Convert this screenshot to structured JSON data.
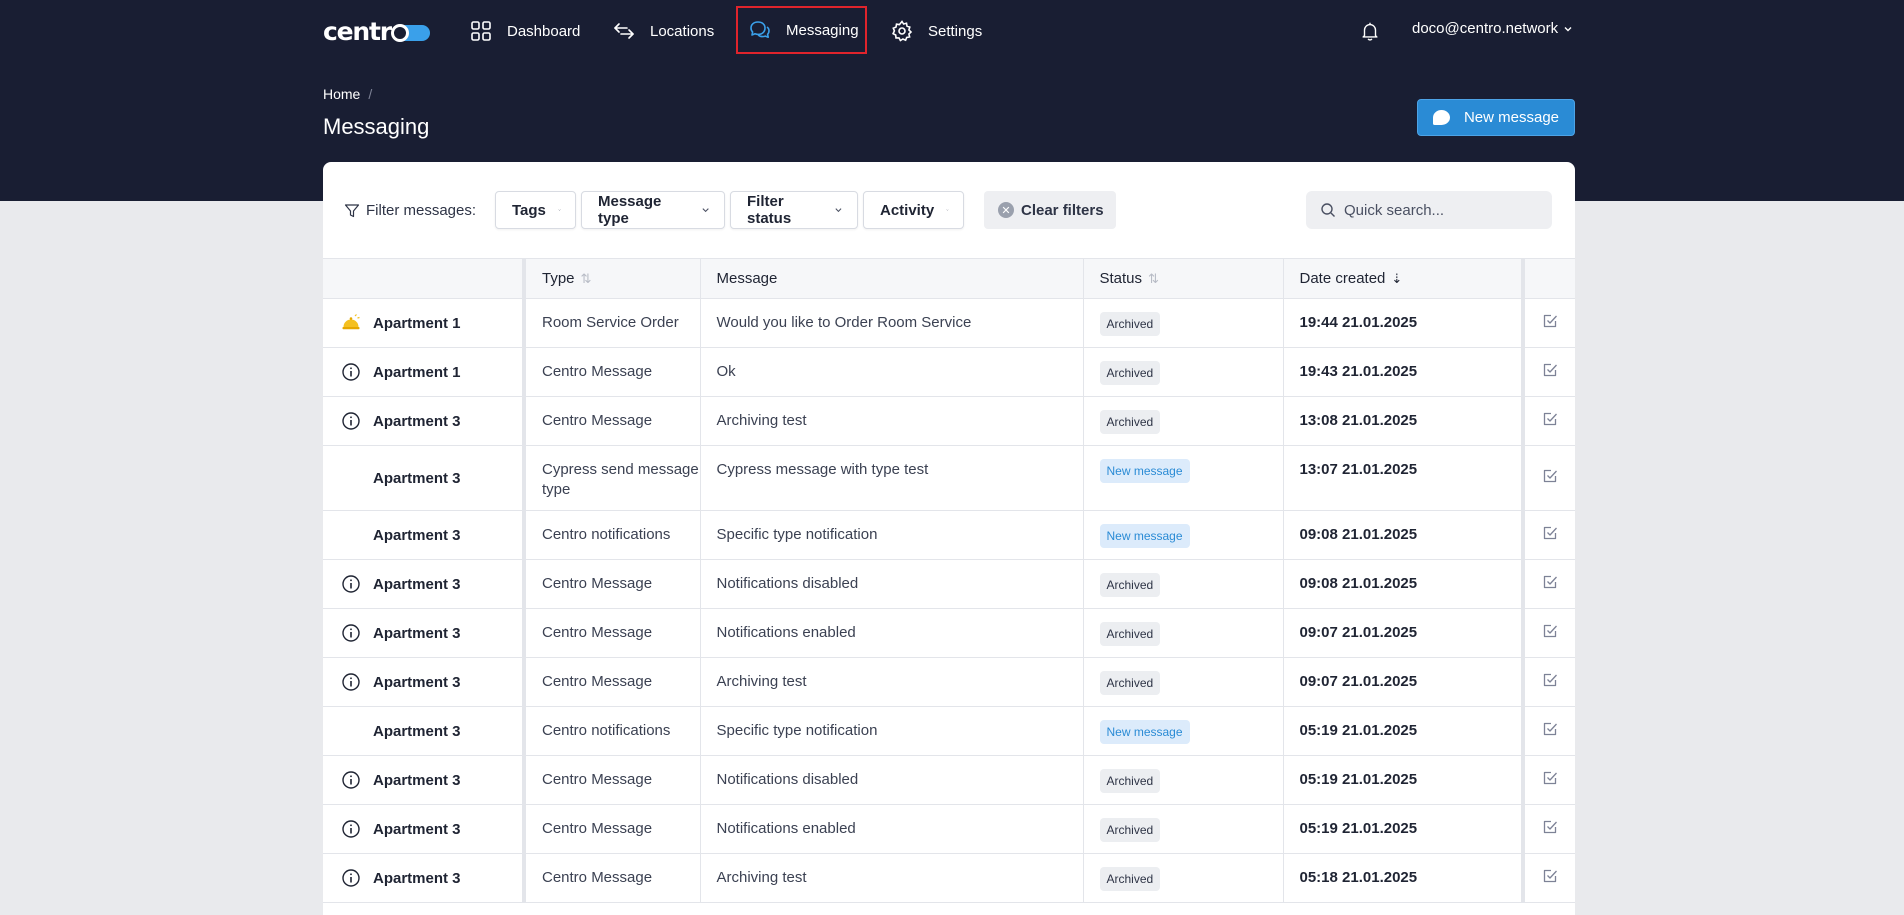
{
  "brand": {
    "logo_text": "centr"
  },
  "nav": {
    "items": [
      {
        "label": "Dashboard",
        "icon": "dashboard-grid-icon"
      },
      {
        "label": "Locations",
        "icon": "arrows-swap-icon"
      },
      {
        "label": "Messaging",
        "icon": "chat-bubbles-icon",
        "active": true
      },
      {
        "label": "Settings",
        "icon": "gear-icon"
      }
    ],
    "user_email": "doco@centro.network"
  },
  "breadcrumb": {
    "home": "Home",
    "separator": "/"
  },
  "page_title": "Messaging",
  "new_message_button": "New message",
  "filters": {
    "label": "Filter messages:",
    "tags": "Tags",
    "message_type": "Message type",
    "filter_status": "Filter status",
    "activity": "Activity",
    "clear": "Clear filters",
    "search_placeholder": "Quick search..."
  },
  "table": {
    "headers": {
      "location": "",
      "type": "Type",
      "message": "Message",
      "status": "Status",
      "date": "Date created"
    },
    "rows": [
      {
        "icon": "room-service-bell-icon",
        "location": "Apartment 1",
        "type": "Room Service Order",
        "message": "Would you like to Order Room Service",
        "status": "Archived",
        "date": "19:44 21.01.2025"
      },
      {
        "icon": "info-circle-icon",
        "location": "Apartment 1",
        "type": "Centro Message",
        "message": "Ok",
        "status": "Archived",
        "date": "19:43 21.01.2025"
      },
      {
        "icon": "info-circle-icon",
        "location": "Apartment 3",
        "type": "Centro Message",
        "message": "Archiving test",
        "status": "Archived",
        "date": "13:08 21.01.2025"
      },
      {
        "icon": "",
        "location": "Apartment 3",
        "type": "Cypress send message type",
        "message": "Cypress message with type test",
        "status": "New message",
        "date": "13:07 21.01.2025"
      },
      {
        "icon": "",
        "location": "Apartment 3",
        "type": "Centro notifications",
        "message": "Specific type notification",
        "status": "New message",
        "date": "09:08 21.01.2025"
      },
      {
        "icon": "info-circle-icon",
        "location": "Apartment 3",
        "type": "Centro Message",
        "message": "Notifications disabled",
        "status": "Archived",
        "date": "09:08 21.01.2025"
      },
      {
        "icon": "info-circle-icon",
        "location": "Apartment 3",
        "type": "Centro Message",
        "message": "Notifications enabled",
        "status": "Archived",
        "date": "09:07 21.01.2025"
      },
      {
        "icon": "info-circle-icon",
        "location": "Apartment 3",
        "type": "Centro Message",
        "message": "Archiving test",
        "status": "Archived",
        "date": "09:07 21.01.2025"
      },
      {
        "icon": "",
        "location": "Apartment 3",
        "type": "Centro notifications",
        "message": "Specific type notification",
        "status": "New message",
        "date": "05:19 21.01.2025"
      },
      {
        "icon": "info-circle-icon",
        "location": "Apartment 3",
        "type": "Centro Message",
        "message": "Notifications disabled",
        "status": "Archived",
        "date": "05:19 21.01.2025"
      },
      {
        "icon": "info-circle-icon",
        "location": "Apartment 3",
        "type": "Centro Message",
        "message": "Notifications enabled",
        "status": "Archived",
        "date": "05:19 21.01.2025"
      },
      {
        "icon": "info-circle-icon",
        "location": "Apartment 3",
        "type": "Centro Message",
        "message": "Archiving test",
        "status": "Archived",
        "date": "05:18 21.01.2025"
      }
    ]
  },
  "colors": {
    "header_bg": "#191e33",
    "accent": "#2a8bd5",
    "active_outline": "#e0242c"
  }
}
